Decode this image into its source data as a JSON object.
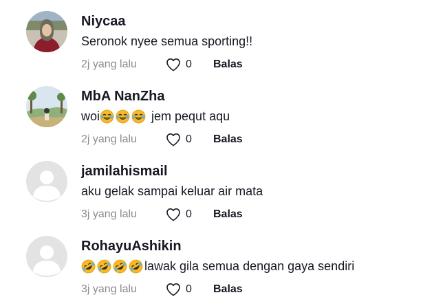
{
  "comments": [
    {
      "username": "Niycaa",
      "text": "Seronok nyee semua sporting!!",
      "time": "2j yang lalu",
      "likes": "0",
      "reply_label": "Balas",
      "avatar": "photo-avatar-woman"
    },
    {
      "username": "MbA NanZha",
      "text_prefix": "woi",
      "text_suffix": "jem pequt aqu",
      "emoji": "tears-of-joy-emoji",
      "emoji_count": 3,
      "time": "2j yang lalu",
      "likes": "0",
      "reply_label": "Balas",
      "avatar": "photo-avatar-landscape"
    },
    {
      "username": "jamilahismail",
      "text": "aku gelak sampai keluar air mata",
      "time": "3j yang lalu",
      "likes": "0",
      "reply_label": "Balas",
      "avatar": "default-avatar"
    },
    {
      "username": "RohayuAshikin",
      "text_suffix": "lawak gila semua dengan gaya sendiri",
      "emoji": "rolling-on-floor-laughing-emoji",
      "emoji_count": 4,
      "time": "3j yang lalu",
      "likes": "0",
      "reply_label": "Balas",
      "avatar": "default-avatar"
    }
  ],
  "colors": {
    "text": "#161823",
    "muted": "#8a8b91",
    "default_avatar_bg": "#e3e3e4",
    "emoji_yellow": "#f7b928"
  }
}
